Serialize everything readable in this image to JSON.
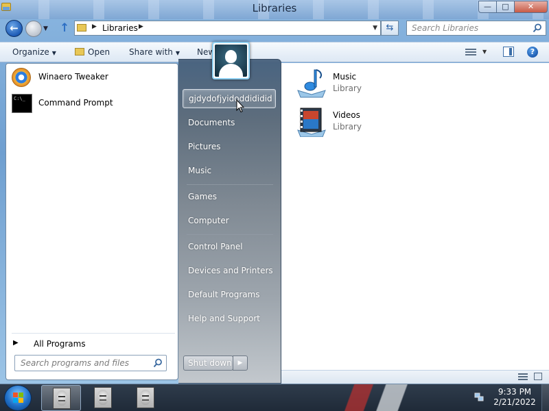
{
  "window": {
    "title": "Libraries",
    "minimize_glyph": "—",
    "maximize_glyph": "□",
    "close_glyph": "✕"
  },
  "address": {
    "crumb": "Libraries"
  },
  "search": {
    "placeholder": "Search Libraries"
  },
  "toolbar": {
    "organize": "Organize",
    "open": "Open",
    "share_with": "Share with",
    "new": "New"
  },
  "libraries": [
    {
      "name": "Music",
      "type": "Library",
      "icon": "music-library-icon"
    },
    {
      "name": "Videos",
      "type": "Library",
      "icon": "videos-library-icon"
    }
  ],
  "start_menu": {
    "pinned": [
      {
        "label": "Winaero Tweaker",
        "icon": "winaero-tweaker-icon"
      },
      {
        "label": "Command Prompt",
        "icon": "command-prompt-icon"
      }
    ],
    "all_programs": "All Programs",
    "search_placeholder": "Search programs and files",
    "user_name": "gjdydofjyidoddididid",
    "right_items": [
      "Documents",
      "Pictures",
      "Music",
      "Games",
      "Computer",
      "Control Panel",
      "Devices and Printers",
      "Default Programs",
      "Help and Support"
    ],
    "shutdown": "Shut down"
  },
  "taskbar": {
    "time": "9:33 PM",
    "date": "2/21/2022"
  },
  "colors": {
    "accent": "#1d5bb6",
    "start_right_top": "#46607c",
    "start_right_bottom": "#c4c8cc"
  }
}
